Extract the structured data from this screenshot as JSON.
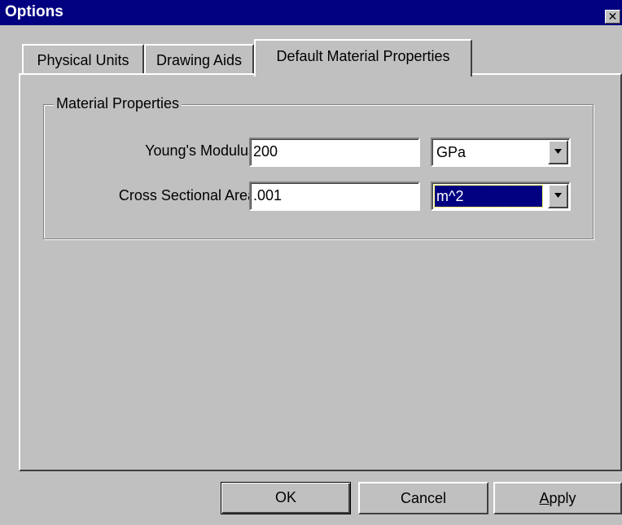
{
  "window": {
    "title": "Options",
    "close_symbol": "✕"
  },
  "tabs": [
    {
      "label": "Physical Units",
      "active": false
    },
    {
      "label": "Drawing Aids",
      "active": false
    },
    {
      "label": "Default Material Properties",
      "active": true
    }
  ],
  "group": {
    "label": "Material Properties",
    "fields": [
      {
        "label": "Young's Modulus",
        "value": "200",
        "unit": "GPa"
      },
      {
        "label": "Cross Sectional Area",
        "value": ".001",
        "unit": "m^2"
      }
    ]
  },
  "buttons": {
    "ok": "OK",
    "cancel": "Cancel",
    "apply_accel": "A",
    "apply_rest": "pply"
  },
  "icons": {
    "close": "close-icon",
    "dropdown": "chevron-down-icon"
  },
  "colors": {
    "title_bar": "#000080",
    "face": "#c0c0c0",
    "selection": "#000080"
  }
}
